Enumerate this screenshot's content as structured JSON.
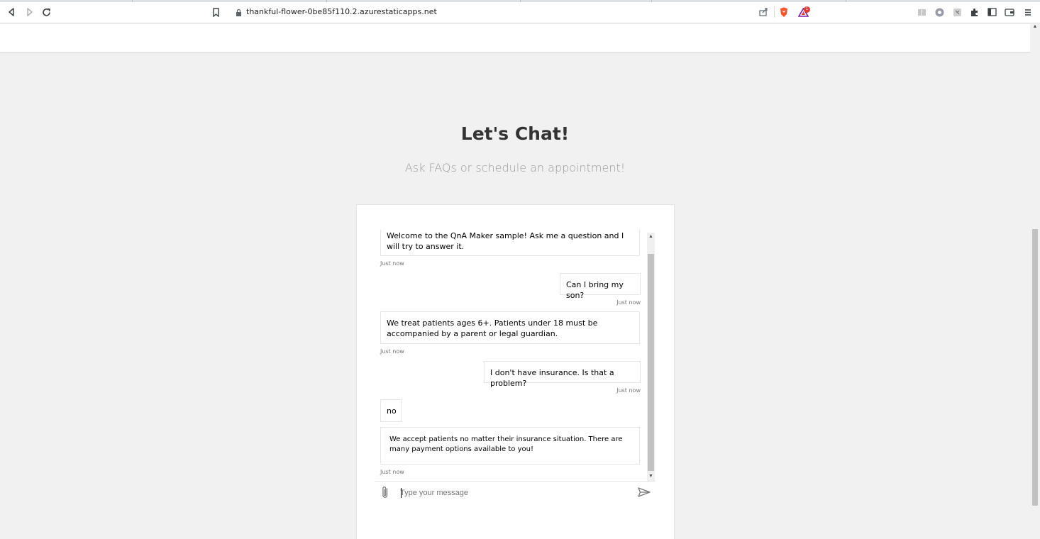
{
  "browser": {
    "url": "thankful-flower-0be85f110.2.azurestaticapps.net",
    "icons": [
      "back-icon",
      "forward-icon",
      "reload-icon",
      "bookmark-icon",
      "lock-icon",
      "share-icon",
      "brave-shield-icon",
      "brave-rewards-icon",
      "reading-list-icon",
      "extension-icon",
      "puzzle-icon",
      "sidebar-icon",
      "wallet-icon",
      "menu-icon"
    ],
    "rewards_badge": "1"
  },
  "page": {
    "title": "Let's Chat!",
    "subtitle": "Ask FAQs or schedule an appointment!"
  },
  "chat": {
    "messages": [
      {
        "from": "bot",
        "text": "Welcome to the QnA Maker sample! Ask me a question and I will try to answer it.",
        "timestamp": "Just now"
      },
      {
        "from": "user",
        "text": "Can I bring my son?",
        "timestamp": "Just now"
      },
      {
        "from": "bot",
        "text": "We treat patients ages 6+. Patients under 18 must be accompanied by a parent or legal guardian.",
        "timestamp": "Just now"
      },
      {
        "from": "user",
        "text": "I don't have insurance. Is that a problem?",
        "timestamp": "Just now"
      },
      {
        "from": "bot",
        "text": "no",
        "timestamp": ""
      },
      {
        "from": "bot",
        "text": "We accept patients no matter their insurance situation. There are many payment options available to you!",
        "timestamp": "Just now"
      }
    ],
    "input_placeholder": "Type your message",
    "input_value": ""
  },
  "colors": {
    "page_background": "#f1f1f1",
    "card_background": "#ffffff",
    "title_text": "#333333",
    "subtitle_text": "#9a9a9a",
    "timestamp_text": "#767676"
  }
}
